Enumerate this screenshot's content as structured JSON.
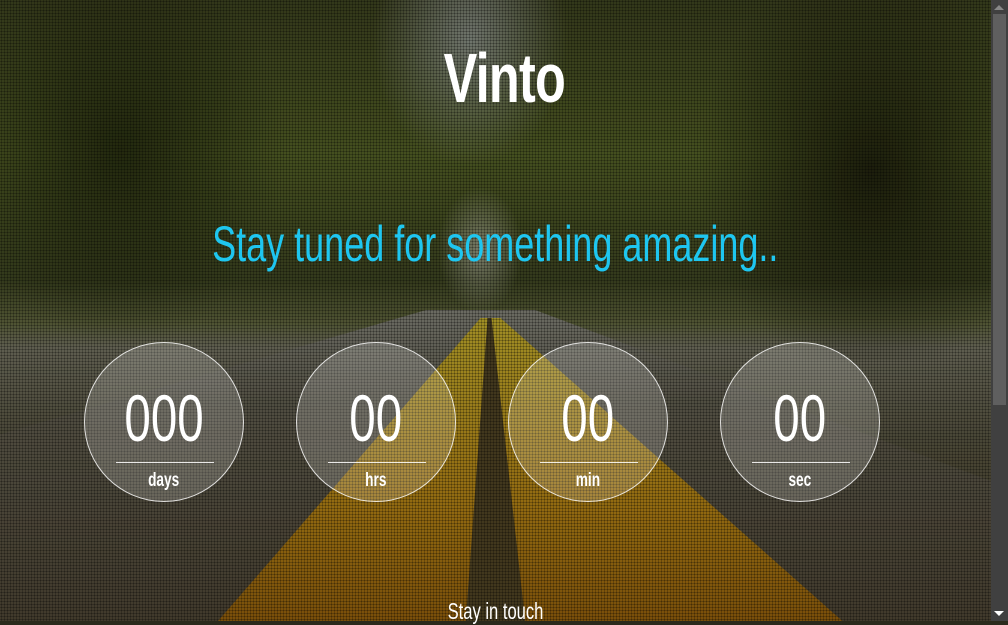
{
  "site": {
    "title": "Vinto",
    "tagline": "Stay tuned for something amazing.."
  },
  "countdown": [
    {
      "value": "000",
      "label": "days"
    },
    {
      "value": "00",
      "label": "hrs"
    },
    {
      "value": "00",
      "label": "min"
    },
    {
      "value": "00",
      "label": "sec"
    }
  ],
  "footer": {
    "heading": "Stay in touch"
  },
  "colors": {
    "accent": "#1ec6f0"
  }
}
